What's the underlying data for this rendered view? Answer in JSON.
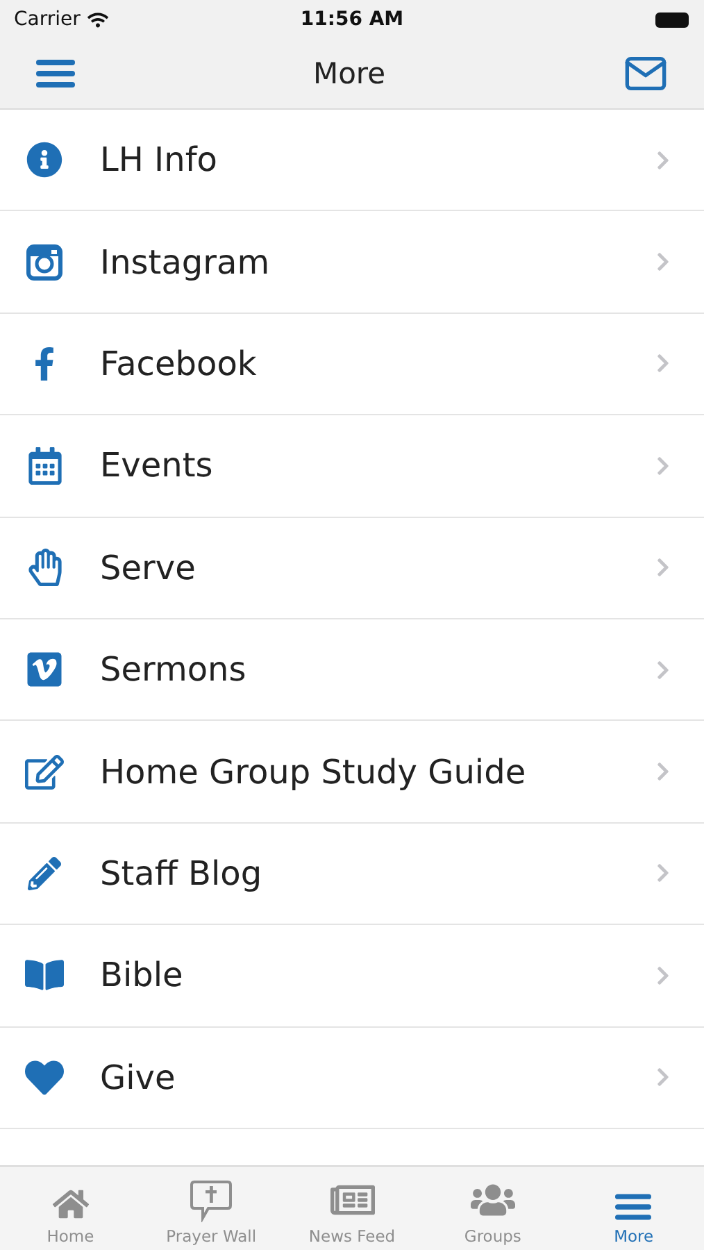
{
  "status_bar": {
    "carrier": "Carrier",
    "time": "11:56 AM"
  },
  "nav_bar": {
    "title": "More"
  },
  "items": [
    {
      "label": "LH Info"
    },
    {
      "label": "Instagram"
    },
    {
      "label": "Facebook"
    },
    {
      "label": "Events"
    },
    {
      "label": "Serve"
    },
    {
      "label": "Sermons"
    },
    {
      "label": "Home Group Study Guide"
    },
    {
      "label": "Staff Blog"
    },
    {
      "label": "Bible"
    },
    {
      "label": "Give"
    }
  ],
  "tab_bar": [
    {
      "label": "Home",
      "selected": false
    },
    {
      "label": "Prayer Wall",
      "selected": false
    },
    {
      "label": "News Feed",
      "selected": false
    },
    {
      "label": "Groups",
      "selected": false
    },
    {
      "label": "More",
      "selected": true
    }
  ]
}
